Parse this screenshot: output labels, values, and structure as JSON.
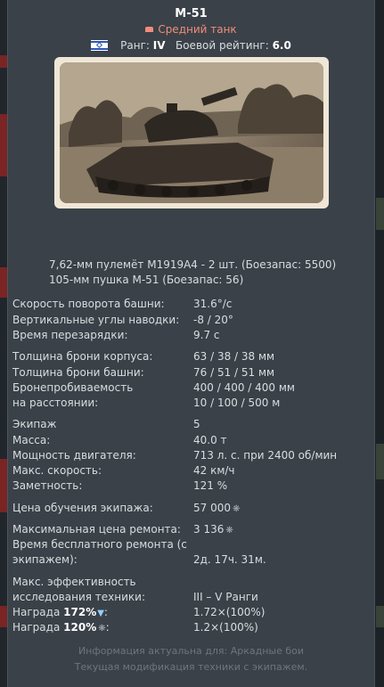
{
  "vehicle": {
    "name": "M-51",
    "type": "Средний танк",
    "rank_label": "Ранг:",
    "rank_value": "IV",
    "br_label": "Боевой рейтинг:",
    "br_value": "6.0"
  },
  "weapons": [
    "7,62-мм пулемёт M1919A4 - 2 шт. (Боезапас: 5500)",
    "105-мм пушка M-51 (Боезапас: 56)"
  ],
  "stats": {
    "turret_rotation": {
      "label": "Скорость поворота башни:",
      "value": "31.6°/с"
    },
    "vertical_angles": {
      "label": "Вертикальные углы наводки:",
      "value": "-8 / 20°"
    },
    "reload": {
      "label": "Время перезарядки:",
      "value": "9.7 с"
    },
    "hull_armor": {
      "label": "Толщина брони корпуса:",
      "value": "63 / 38 / 38 мм"
    },
    "turret_armor": {
      "label": "Толщина брони башни:",
      "value": "76 / 51 / 51 мм"
    },
    "penetration": {
      "label": "Бронепробиваемость",
      "value": "400 / 400 / 400 мм"
    },
    "distance": {
      "label": "на расстоянии:",
      "value": "10 / 100 / 500 м"
    },
    "crew": {
      "label": "Экипаж",
      "value": "5"
    },
    "mass": {
      "label": "Масса:",
      "value": "40.0 т"
    },
    "engine": {
      "label": "Мощность двигателя:",
      "value": "713 л. с. при 2400 об/мин"
    },
    "max_speed": {
      "label": "Макс. скорость:",
      "value": "42 км/ч"
    },
    "visibility": {
      "label": "Заметность:",
      "value": "121 %"
    },
    "crew_training": {
      "label": "Цена обучения экипажа:",
      "value": "57 000"
    },
    "max_repair": {
      "label": "Максимальная цена ремонта:",
      "value": "3 136"
    },
    "free_repair": {
      "label_line1": "Время бесплатного ремонта (с",
      "label_line2": "экипажем):",
      "value": "2д. 17ч. 31м."
    },
    "research": {
      "label_line1": "Макс. эффективность",
      "label_line2": "исследования техники:",
      "value": "III – V Ранги"
    },
    "reward_rp": {
      "label_prefix": "Награда",
      "label_pct": "172%",
      "value": "1.72×(100%)"
    },
    "reward_sl": {
      "label_prefix": "Награда",
      "label_pct": "120%",
      "value": "1.2×(100%)"
    }
  },
  "footer": {
    "line1": "Информация актуальна для: Аркадные бои",
    "line2": "Текущая модификация техники с экипажем."
  },
  "icons": {
    "type": "medium-tank-icon",
    "flag": "israel-flag-icon",
    "silver": "silver-lions-icon",
    "rp": "research-points-icon"
  },
  "colors": {
    "panel_bg": "#3a4148",
    "vehicle_type": "#f08c7c",
    "footer_text": "#6d767d"
  }
}
